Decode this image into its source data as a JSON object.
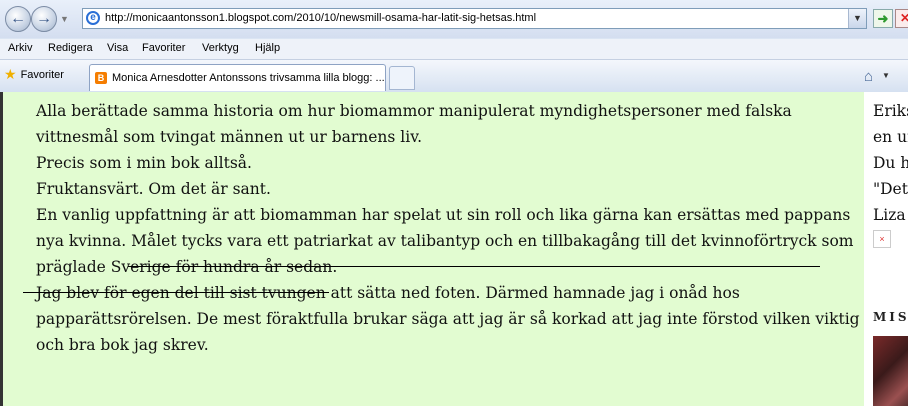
{
  "browser": {
    "url": "http://monicaantonsson1.blogspot.com/2010/10/newsmill-osama-har-latit-sig-hetsas.html",
    "menu": [
      "Arkiv",
      "Redigera",
      "Visa",
      "Favoriter",
      "Verktyg",
      "Hjälp"
    ],
    "favorites_label": "Favoriter",
    "tab_title": "Monica Arnesdotter Antonssons trivsamma lilla blogg: ..."
  },
  "post": {
    "lines": [
      "Alla berättade samma historia om hur biomammor manipulerat myndighetspersoner med falska",
      "vittnesmål som tvingat männen ut ur barnens liv.",
      "Precis som i min bok alltså.",
      "Fruktansvärt. Om det är sant.",
      "En vanlig uppfattning är att biomamman har spelat ut sin roll och lika gärna kan ersättas med pappans",
      "nya kvinna.",
      "Målet tycks vara ett patriarkat av talibantyp och en tillbakagång till det kvinnoförtryck som",
      "präglade Sverige för hundra år sedan.",
      "Jag blev för egen del till sist tvungen att sätta ned foten. Därmed hamnade jag i onåd hos",
      "papparättsrörelsen. De mest föraktfulla brukar säga att jag är så korkad att jag inte förstod vilken viktig",
      "och bra bok jag skrev."
    ]
  },
  "sidebar": {
    "lines": [
      "Eriks",
      "en ur",
      "Du h",
      "\"Det",
      "Liza"
    ],
    "heading": "MIS"
  },
  "colors": {
    "content_bg": "#e2fcd1"
  }
}
